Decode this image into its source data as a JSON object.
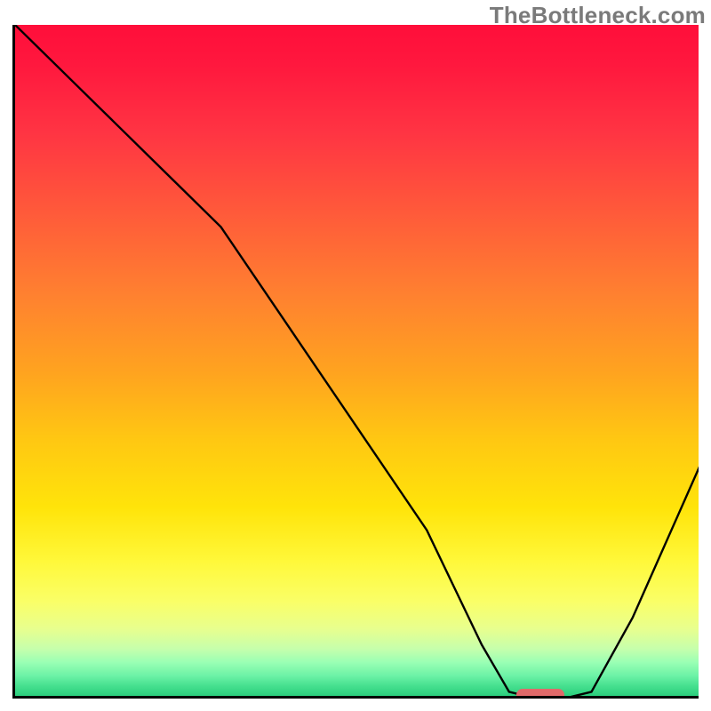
{
  "watermark": "TheBottleneck.com",
  "chart_data": {
    "type": "line",
    "title": "",
    "xlabel": "",
    "ylabel": "",
    "xlim": [
      0,
      100
    ],
    "ylim": [
      0,
      100
    ],
    "series": [
      {
        "name": "bottleneck-curve",
        "x": [
          0,
          10,
          20,
          25,
          30,
          40,
          50,
          60,
          68,
          72,
          76,
          80,
          84,
          90,
          100
        ],
        "y": [
          100,
          90,
          80,
          75,
          70,
          55,
          40,
          25,
          8,
          1,
          0,
          0,
          1,
          12,
          35
        ]
      }
    ],
    "marker": {
      "x_start": 73,
      "x_end": 80,
      "y": 0.5,
      "color": "#e06a6a"
    },
    "gradient": {
      "top_color": "#ff0e3a",
      "bottom_color": "#2bce7d",
      "description": "vertical red-to-green heat gradient"
    }
  }
}
